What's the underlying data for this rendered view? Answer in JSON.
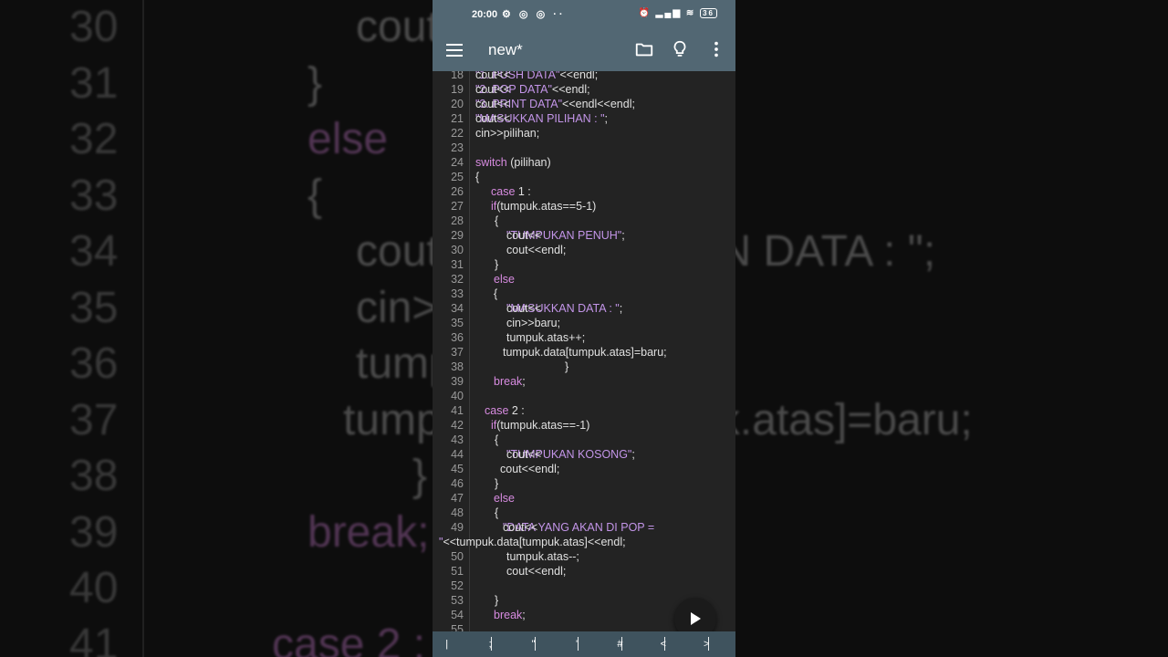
{
  "app": {
    "title": "new*",
    "status_bar": {
      "time": "20:00",
      "battery": "36"
    }
  },
  "editor": {
    "lines": [
      {
        "num": "18",
        "parts": [
          {
            "t": "cout<<",
            "c": "code"
          },
          {
            "t": "\"1. PUSH DATA\"",
            "c": "str"
          },
          {
            "t": "<<endl;",
            "c": "code"
          }
        ],
        "indent": 20
      },
      {
        "num": "19",
        "parts": [
          {
            "t": "cout<<",
            "c": "code"
          },
          {
            "t": "\"2. POP DATA\"",
            "c": "str"
          },
          {
            "t": "<<endl;",
            "c": "code"
          }
        ],
        "indent": 20
      },
      {
        "num": "20",
        "parts": [
          {
            "t": "cout<<",
            "c": "code"
          },
          {
            "t": "\"3. PRINT DATA\"",
            "c": "str"
          },
          {
            "t": "<<endl<<endl;",
            "c": "code"
          }
        ],
        "indent": 20
      },
      {
        "num": "21",
        "parts": [
          {
            "t": "cout<<",
            "c": "code"
          },
          {
            "t": "\"MASUKKAN PILIHAN : \"",
            "c": "str"
          },
          {
            "t": ";",
            "c": "code"
          }
        ],
        "indent": 20
      },
      {
        "num": "22",
        "parts": [
          {
            "t": "cin>>pilihan;",
            "c": "code"
          }
        ],
        "indent": 20
      },
      {
        "num": "23",
        "parts": [],
        "indent": 20
      },
      {
        "num": "24",
        "parts": [
          {
            "t": "switch",
            "c": "kw"
          },
          {
            "t": " (pilihan)",
            "c": "code"
          }
        ],
        "indent": 20
      },
      {
        "num": "25",
        "parts": [
          {
            "t": "{",
            "c": "code"
          }
        ],
        "indent": 20
      },
      {
        "num": "26",
        "parts": [
          {
            "t": "case",
            "c": "kw"
          },
          {
            "t": " 1 :",
            "c": "code"
          }
        ],
        "indent": 37
      },
      {
        "num": "27",
        "parts": [
          {
            "t": "if",
            "c": "kw"
          },
          {
            "t": "(tumpuk.atas==5-1)",
            "c": "code"
          }
        ],
        "indent": 37
      },
      {
        "num": "28",
        "parts": [
          {
            "t": "{",
            "c": "code"
          }
        ],
        "indent": 41
      },
      {
        "num": "29",
        "parts": [
          {
            "t": "cout<<",
            "c": "code"
          },
          {
            "t": "\"TUMPUKAN PENUH\"",
            "c": "str"
          },
          {
            "t": ";",
            "c": "code"
          }
        ],
        "indent": 54
      },
      {
        "num": "30",
        "parts": [
          {
            "t": "cout<<endl;",
            "c": "code"
          }
        ],
        "indent": 54
      },
      {
        "num": "31",
        "parts": [
          {
            "t": "}",
            "c": "code"
          }
        ],
        "indent": 41
      },
      {
        "num": "32",
        "parts": [
          {
            "t": "else",
            "c": "kw"
          }
        ],
        "indent": 40
      },
      {
        "num": "33",
        "parts": [
          {
            "t": "{",
            "c": "code"
          }
        ],
        "indent": 40
      },
      {
        "num": "34",
        "parts": [
          {
            "t": "cout<<",
            "c": "code"
          },
          {
            "t": "\"MASUKKAN DATA : \"",
            "c": "str"
          },
          {
            "t": ";",
            "c": "code"
          }
        ],
        "indent": 54
      },
      {
        "num": "35",
        "parts": [
          {
            "t": "cin>>baru;",
            "c": "code"
          }
        ],
        "indent": 54
      },
      {
        "num": "36",
        "parts": [
          {
            "t": "tumpuk.atas++;",
            "c": "code"
          }
        ],
        "indent": 54
      },
      {
        "num": "37",
        "parts": [
          {
            "t": "tumpuk.data[tumpuk.atas]=baru;",
            "c": "code"
          }
        ],
        "indent": 50
      },
      {
        "num": "38",
        "parts": [
          {
            "t": "}",
            "c": "code"
          }
        ],
        "indent": 118
      },
      {
        "num": "39",
        "parts": [
          {
            "t": "break",
            "c": "kw"
          },
          {
            "t": ";",
            "c": "code"
          }
        ],
        "indent": 40
      },
      {
        "num": "40",
        "parts": [],
        "indent": 20
      },
      {
        "num": "41",
        "parts": [
          {
            "t": "case",
            "c": "kw"
          },
          {
            "t": " 2 :",
            "c": "code"
          }
        ],
        "indent": 30
      },
      {
        "num": "42",
        "parts": [
          {
            "t": "if",
            "c": "kw"
          },
          {
            "t": "(tumpuk.atas==-1)",
            "c": "code"
          }
        ],
        "indent": 37
      },
      {
        "num": "43",
        "parts": [
          {
            "t": "{",
            "c": "code"
          }
        ],
        "indent": 41
      },
      {
        "num": "44",
        "parts": [
          {
            "t": "cout<<",
            "c": "code"
          },
          {
            "t": "\"TUMPUKAN KOSONG\"",
            "c": "str"
          },
          {
            "t": ";",
            "c": "code"
          }
        ],
        "indent": 54
      },
      {
        "num": "45",
        "parts": [
          {
            "t": "cout<<endl;",
            "c": "code"
          }
        ],
        "indent": 47
      },
      {
        "num": "46",
        "parts": [
          {
            "t": "}",
            "c": "code"
          }
        ],
        "indent": 41
      },
      {
        "num": "47",
        "parts": [
          {
            "t": "else",
            "c": "kw"
          }
        ],
        "indent": 40
      },
      {
        "num": "48",
        "parts": [
          {
            "t": "{",
            "c": "code"
          }
        ],
        "indent": 41
      },
      {
        "num": "49",
        "parts": [
          {
            "t": "cout<<",
            "c": "code"
          },
          {
            "t": "\"DATA YANG AKAN DI POP =",
            "c": "str"
          }
        ],
        "indent": 50
      },
      {
        "num": "",
        "parts": [
          {
            "t": "\"",
            "c": "str"
          },
          {
            "t": "<<tumpuk.data[tumpuk.atas]<<endl;",
            "c": "code"
          }
        ],
        "indent": 0
      },
      {
        "num": "50",
        "parts": [
          {
            "t": "tumpuk.atas--;",
            "c": "code"
          }
        ],
        "indent": 54
      },
      {
        "num": "51",
        "parts": [
          {
            "t": "cout<<endl;",
            "c": "code"
          }
        ],
        "indent": 54
      },
      {
        "num": "52",
        "parts": [],
        "indent": 20
      },
      {
        "num": "53",
        "parts": [
          {
            "t": "}",
            "c": "code"
          }
        ],
        "indent": 41
      },
      {
        "num": "54",
        "parts": [
          {
            "t": "break",
            "c": "kw"
          },
          {
            "t": ";",
            "c": "code"
          }
        ],
        "indent": 40
      },
      {
        "num": "55",
        "parts": [],
        "indent": 20
      }
    ]
  },
  "key_bar": {
    "keys": [
      "|",
      ";",
      "\"",
      "'",
      "#",
      "<",
      ">"
    ]
  },
  "background": {
    "lines": [
      {
        "num": "30",
        "text": "cout<<endl;",
        "cls": "code",
        "indent": 390
      },
      {
        "num": "31",
        "text": "}",
        "cls": "code",
        "indent": 337
      },
      {
        "num": "32",
        "text": "else",
        "cls": "kw",
        "indent": 337
      },
      {
        "num": "33",
        "text": "{",
        "cls": "code",
        "indent": 337
      },
      {
        "num": "34",
        "text": "cout<<\"MASUKKAN DATA : \";",
        "cls": "code",
        "indent": 390
      },
      {
        "num": "35",
        "text": "cin>>baru;",
        "cls": "code",
        "indent": 390
      },
      {
        "num": "36",
        "text": "tumpuk.atas++;",
        "cls": "code",
        "indent": 390
      },
      {
        "num": "37",
        "text": "tumpuk.data[tumpuk.atas]=baru;",
        "cls": "code",
        "indent": 376
      },
      {
        "num": "38",
        "text": "}",
        "cls": "code",
        "indent": 452
      },
      {
        "num": "39",
        "text": "break;",
        "cls": "kw",
        "indent": 337
      },
      {
        "num": "40",
        "text": "",
        "cls": "code",
        "indent": 337
      },
      {
        "num": "41",
        "text": "case 2 :",
        "cls": "kw",
        "indent": 298
      }
    ]
  }
}
